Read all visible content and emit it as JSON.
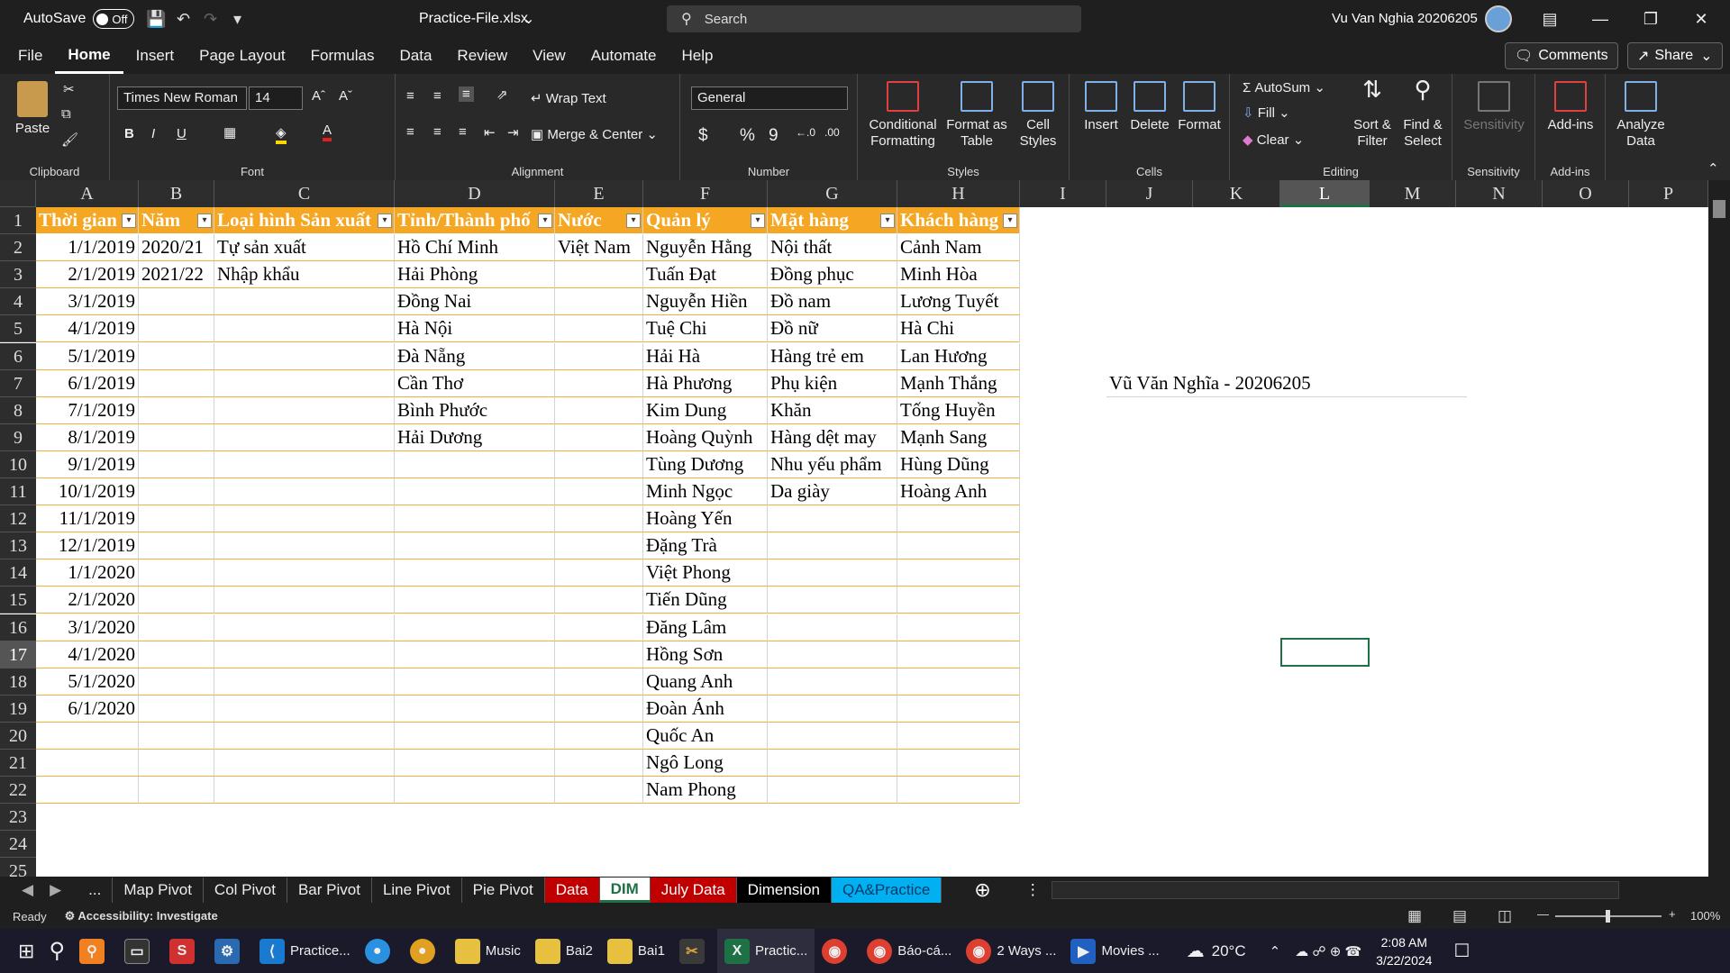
{
  "titlebar": {
    "autosave_label": "AutoSave",
    "toggle_state": "Off",
    "filename": "Practice-File.xlsx",
    "search_placeholder": "Search",
    "user": "Vu Van Nghia 20206205"
  },
  "menu": {
    "tabs": [
      "File",
      "Home",
      "Insert",
      "Page Layout",
      "Formulas",
      "Data",
      "Review",
      "View",
      "Automate",
      "Help"
    ],
    "active": "Home",
    "comments": "Comments",
    "share": "Share"
  },
  "ribbon": {
    "clipboard": {
      "paste": "Paste",
      "label": "Clipboard"
    },
    "font": {
      "name": "Times New Roman",
      "size": "14",
      "bold": "B",
      "italic": "I",
      "underline": "U",
      "label": "Font"
    },
    "alignment": {
      "wrap": "Wrap Text",
      "merge": "Merge & Center",
      "label": "Alignment"
    },
    "number": {
      "format": "General",
      "dollar": "$",
      "percent": "%",
      "comma": "9",
      "label": "Number"
    },
    "styles": {
      "cond1": "Conditional",
      "cond2": "Formatting",
      "fmt1": "Format as",
      "fmt2": "Table",
      "cell1": "Cell",
      "cell2": "Styles",
      "label": "Styles"
    },
    "cells": {
      "insert": "Insert",
      "delete": "Delete",
      "format": "Format",
      "label": "Cells"
    },
    "editing": {
      "autosum": "AutoSum",
      "fill": "Fill",
      "clear": "Clear",
      "sort1": "Sort &",
      "sort2": "Filter",
      "find1": "Find &",
      "find2": "Select",
      "label": "Editing"
    },
    "sensitivity": {
      "btn": "Sensitivity",
      "label": "Sensitivity"
    },
    "addins": {
      "btn": "Add-ins",
      "label": "Add-ins",
      "analyze1": "Analyze",
      "analyze2": "Data"
    }
  },
  "grid": {
    "columns": [
      "A",
      "B",
      "C",
      "D",
      "E",
      "F",
      "G",
      "H",
      "I",
      "J",
      "K",
      "L",
      "M",
      "N",
      "O",
      "P"
    ],
    "rows": [
      "1",
      "2",
      "3",
      "4",
      "5",
      "6",
      "7",
      "8",
      "9",
      "10",
      "11",
      "12",
      "13",
      "14",
      "15",
      "16",
      "17",
      "18",
      "19",
      "20",
      "21",
      "22",
      "23",
      "24",
      "25"
    ],
    "headers": [
      "Thời gian",
      "Năm",
      "Loại hình Sản xuất",
      "Tỉnh/Thành phố",
      "Nước",
      "Quản lý",
      "Mặt hàng",
      "Khách hàng"
    ],
    "colA": [
      "1/1/2019",
      "2/1/2019",
      "3/1/2019",
      "4/1/2019",
      "5/1/2019",
      "6/1/2019",
      "7/1/2019",
      "8/1/2019",
      "9/1/2019",
      "10/1/2019",
      "11/1/2019",
      "12/1/2019",
      "1/1/2020",
      "2/1/2020",
      "3/1/2020",
      "4/1/2020",
      "5/1/2020",
      "6/1/2020",
      "",
      "",
      ""
    ],
    "colB": [
      "2020/21",
      "2021/22"
    ],
    "colC": [
      "Tự sản xuất",
      "Nhập khẩu"
    ],
    "colD": [
      "Hồ Chí Minh",
      "Hải Phòng",
      "Đồng Nai",
      "Hà Nội",
      "Đà Nẵng",
      "Cần Thơ",
      "Bình Phước",
      "Hải Dương"
    ],
    "colE": [
      "Việt Nam"
    ],
    "colF": [
      "Nguyễn Hằng",
      "Tuấn Đạt",
      "Nguyễn Hiền",
      "Tuệ Chi",
      "Hải Hà",
      "Hà Phương",
      "Kim Dung",
      "Hoàng Quỳnh",
      "Tùng Dương",
      "Minh Ngọc",
      "Hoàng Yến",
      "Đặng Trà",
      "Việt Phong",
      "Tiến Dũng",
      "Đăng Lâm",
      "Hồng Sơn",
      "Quang Anh",
      "Đoàn Ánh",
      "Quốc An",
      "Ngô Long",
      "Nam Phong"
    ],
    "colG": [
      "Nội thất",
      "Đồng phục",
      "Đồ nam",
      "Đồ nữ",
      "Hàng trẻ em",
      "Phụ kiện",
      "Khăn",
      "Hàng dệt may",
      "Nhu yếu phẩm",
      "Da giày"
    ],
    "colH": [
      "Cảnh Nam",
      "Minh Hòa",
      "Lương Tuyết",
      "Hà Chi",
      "Lan Hương",
      "Mạnh Thắng",
      "Tống Huyền",
      "Mạnh Sang",
      "Hùng Dũng",
      "Hoàng Anh"
    ],
    "note": "Vũ Văn Nghĩa - 20206205"
  },
  "sheets": [
    {
      "name": "...",
      "color": ""
    },
    {
      "name": "Map Pivot",
      "color": ""
    },
    {
      "name": "Col Pivot",
      "color": ""
    },
    {
      "name": "Bar Pivot",
      "color": ""
    },
    {
      "name": "Line Pivot",
      "color": ""
    },
    {
      "name": "Pie Pivot",
      "color": ""
    },
    {
      "name": "Data",
      "color": "#c00000"
    },
    {
      "name": "DIM",
      "color": "#ffffff",
      "active": true
    },
    {
      "name": "July Data",
      "color": "#c00000"
    },
    {
      "name": "Dimension",
      "color": "#000000"
    },
    {
      "name": "QA&Practice",
      "color": "#00b0f0"
    }
  ],
  "status": {
    "ready": "Ready",
    "accessibility": "Accessibility: Investigate",
    "zoom": "100%"
  },
  "taskbar": {
    "items": [
      "Practice...",
      "Music",
      "Bai2",
      "Bai1",
      "Practic...",
      "Báo-cá...",
      "2 Ways ...",
      "Movies ..."
    ],
    "weather": "20°C",
    "time": "2:08 AM",
    "date": "3/22/2024"
  }
}
